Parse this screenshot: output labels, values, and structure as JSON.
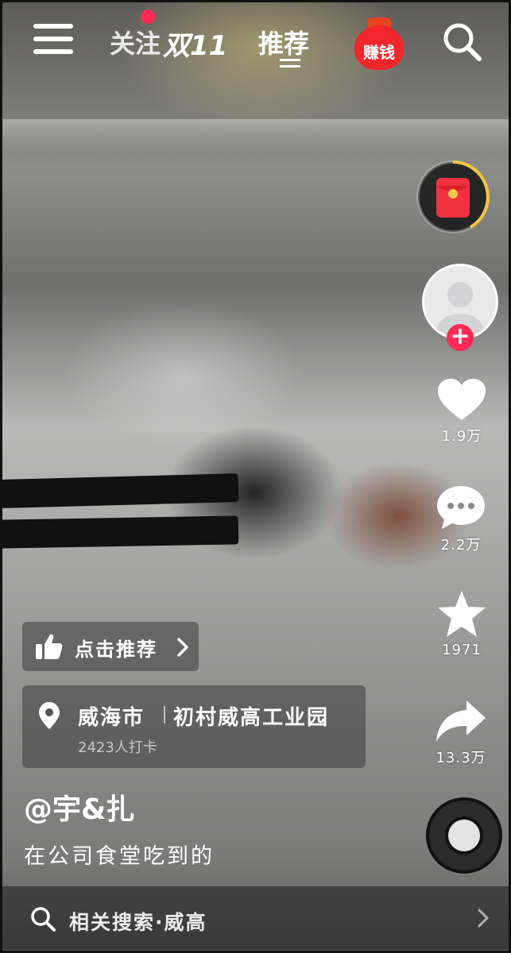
{
  "top_nav": {
    "follow_tab": "关注",
    "double11_tab": "双11",
    "recommend_tab": "推荐",
    "earn_label": "赚钱"
  },
  "icons": {
    "menu": "menu-icon",
    "search": "search-icon",
    "red_packet": "red-packet-icon",
    "like": "heart-icon",
    "comment": "comment-icon",
    "favorite": "star-icon",
    "share": "share-icon",
    "location": "location-pin-icon",
    "thumbs_up": "thumbs-up-icon",
    "music_disc": "music-disc-icon"
  },
  "actions": {
    "like_count": "1.9万",
    "comment_count": "2.2万",
    "favorite_count": "1971",
    "share_count": "13.3万"
  },
  "recommend_chip": {
    "label": "点击推荐"
  },
  "location": {
    "city": "威海市",
    "place": "初村威高工业园",
    "checkins": "2423人打卡"
  },
  "post": {
    "author": "@宇&扎",
    "caption": "在公司食堂吃到的"
  },
  "related_search": {
    "label": "相关搜索·威高"
  },
  "colors": {
    "accent_red": "#ff2b55",
    "ring_yellow": "#f4c542"
  }
}
